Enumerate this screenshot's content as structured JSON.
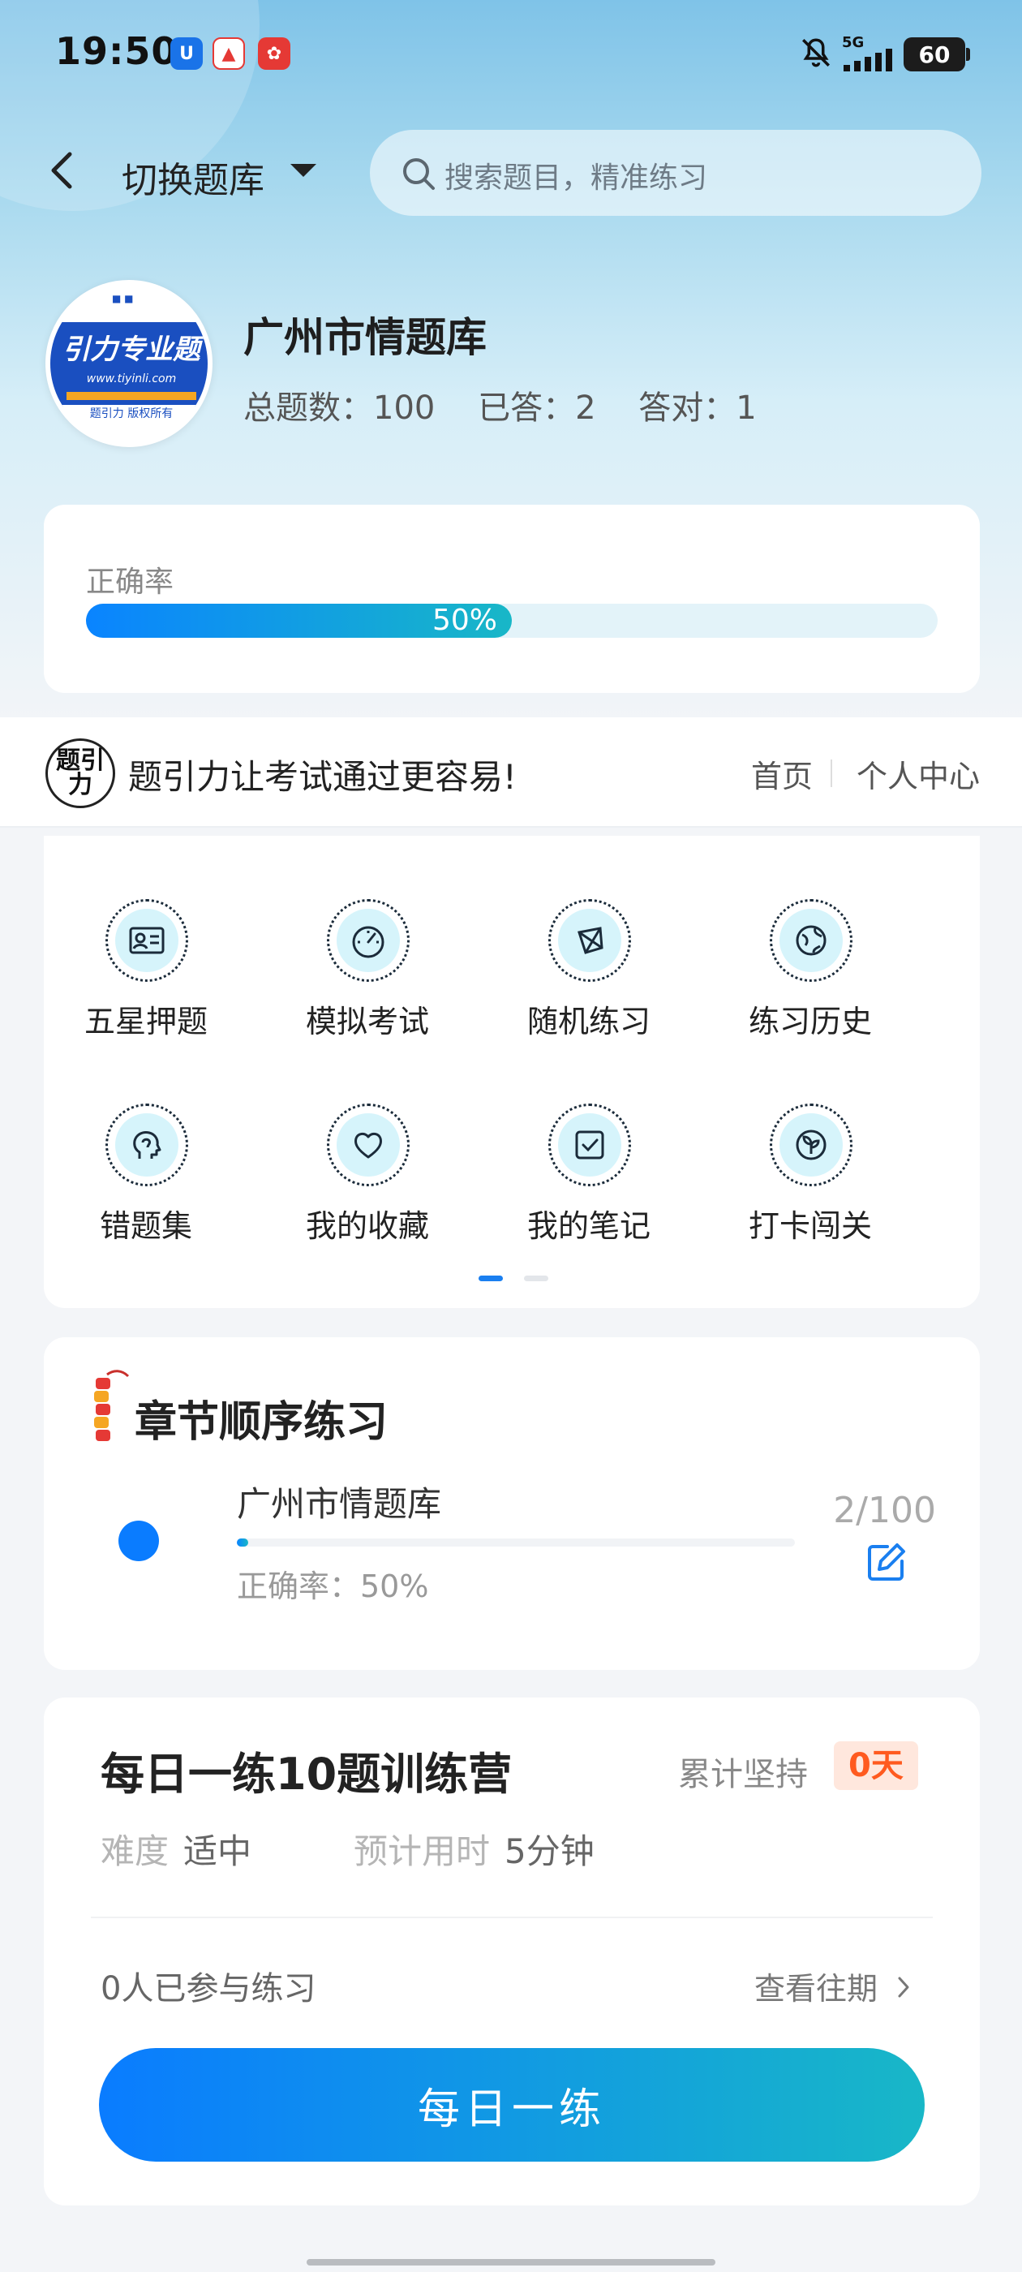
{
  "status_bar": {
    "time": "19:50",
    "network": "5G",
    "battery": "60",
    "icons": [
      "app-shield-icon",
      "app-red-triangle-icon",
      "app-red-flower-icon",
      "mute-bell-icon",
      "signal-icon"
    ]
  },
  "header": {
    "switch_label": "切换题库",
    "search_placeholder": "搜索题目，精准练习"
  },
  "bank": {
    "title": "广州市情题库",
    "avatar_text": "引力专业题",
    "avatar_url": "www.tiyinli.com",
    "avatar_copyright": "题引力 版权所有",
    "stats": {
      "total": "总题数：100",
      "answered": "已答：2",
      "correct": "答对：1"
    }
  },
  "accuracy": {
    "label": "正确率",
    "value_text": "50%",
    "value": 0.5
  },
  "promo": {
    "logo_text": "题引力",
    "slogan": "题引力让考试通过更容易!",
    "home": "首页",
    "user_center": "个人中心"
  },
  "grid": {
    "items": [
      {
        "label": "五星押题",
        "icon": "id-card-icon"
      },
      {
        "label": "模拟考试",
        "icon": "speedometer-icon"
      },
      {
        "label": "随机练习",
        "icon": "network-icon"
      },
      {
        "label": "练习历史",
        "icon": "globe-icon"
      },
      {
        "label": "错题集",
        "icon": "head-icon"
      },
      {
        "label": "我的收藏",
        "icon": "heart-icon"
      },
      {
        "label": "我的笔记",
        "icon": "checklist-icon"
      },
      {
        "label": "打卡闯关",
        "icon": "leaf-icon"
      }
    ],
    "page": 1,
    "pages": 2
  },
  "chapter": {
    "title": "章节顺序练习",
    "item": {
      "name": "广州市情题库",
      "count": "2/100",
      "progress": 0.02,
      "accuracy": "正确率：50%"
    }
  },
  "daily": {
    "title": "每日一练10题训练营",
    "persist_label": "累计坚持",
    "persist_days": "0天",
    "difficulty_label": "难度",
    "difficulty_value": "适中",
    "time_label": "预计用时",
    "time_value": "5分钟",
    "joined": "0人已参与练习",
    "history": "查看往期",
    "button": "每日一练"
  },
  "colors": {
    "accent": "#0a7cff",
    "accent_end": "#18b7c7",
    "badge_bg": "#ffe7dd",
    "badge_text": "#ff5a1f"
  }
}
